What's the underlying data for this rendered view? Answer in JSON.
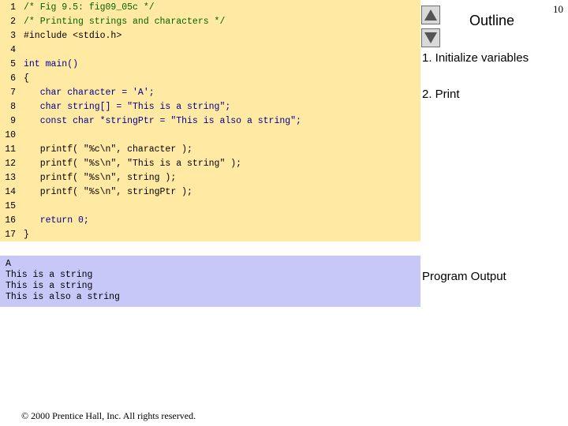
{
  "page_number": "10",
  "outline": {
    "title": "Outline",
    "items": [
      "1. Initialize variables",
      "2. Print"
    ],
    "program_output_label": "Program Output"
  },
  "code": {
    "lines": [
      {
        "num": "1",
        "text": "/* Fig 9.5: fig09_05c */",
        "kind": "comment"
      },
      {
        "num": "2",
        "text": "/* Printing strings and characters */",
        "kind": "comment"
      },
      {
        "num": "3",
        "text": "#include <stdio.h>",
        "kind": "normal"
      },
      {
        "num": "4",
        "text": "",
        "kind": "normal"
      },
      {
        "num": "5",
        "text": "int main()",
        "kind": "keyword"
      },
      {
        "num": "6",
        "text": "{",
        "kind": "normal"
      },
      {
        "num": "7",
        "text": "   char character = 'A';",
        "kind": "keyword"
      },
      {
        "num": "8",
        "text": "   char string[] = \"This is a string\";",
        "kind": "keyword"
      },
      {
        "num": "9",
        "text": "   const char *stringPtr = \"This is also a string\";",
        "kind": "keyword"
      },
      {
        "num": "10",
        "text": "",
        "kind": "normal"
      },
      {
        "num": "11",
        "text": "   printf( \"%c\\n\", character );",
        "kind": "normal"
      },
      {
        "num": "12",
        "text": "   printf( \"%s\\n\", \"This is a string\" );",
        "kind": "normal"
      },
      {
        "num": "13",
        "text": "   printf( \"%s\\n\", string );",
        "kind": "normal"
      },
      {
        "num": "14",
        "text": "   printf( \"%s\\n\", stringPtr );",
        "kind": "normal"
      },
      {
        "num": "15",
        "text": "",
        "kind": "normal"
      },
      {
        "num": "16",
        "text": "   return 0;",
        "kind": "keyword"
      },
      {
        "num": "17",
        "text": "}",
        "kind": "normal"
      }
    ]
  },
  "output": {
    "lines": [
      "A",
      "This is a string",
      "This is a string",
      "This is also a string"
    ]
  },
  "copyright": "© 2000 Prentice Hall, Inc.  All rights reserved."
}
